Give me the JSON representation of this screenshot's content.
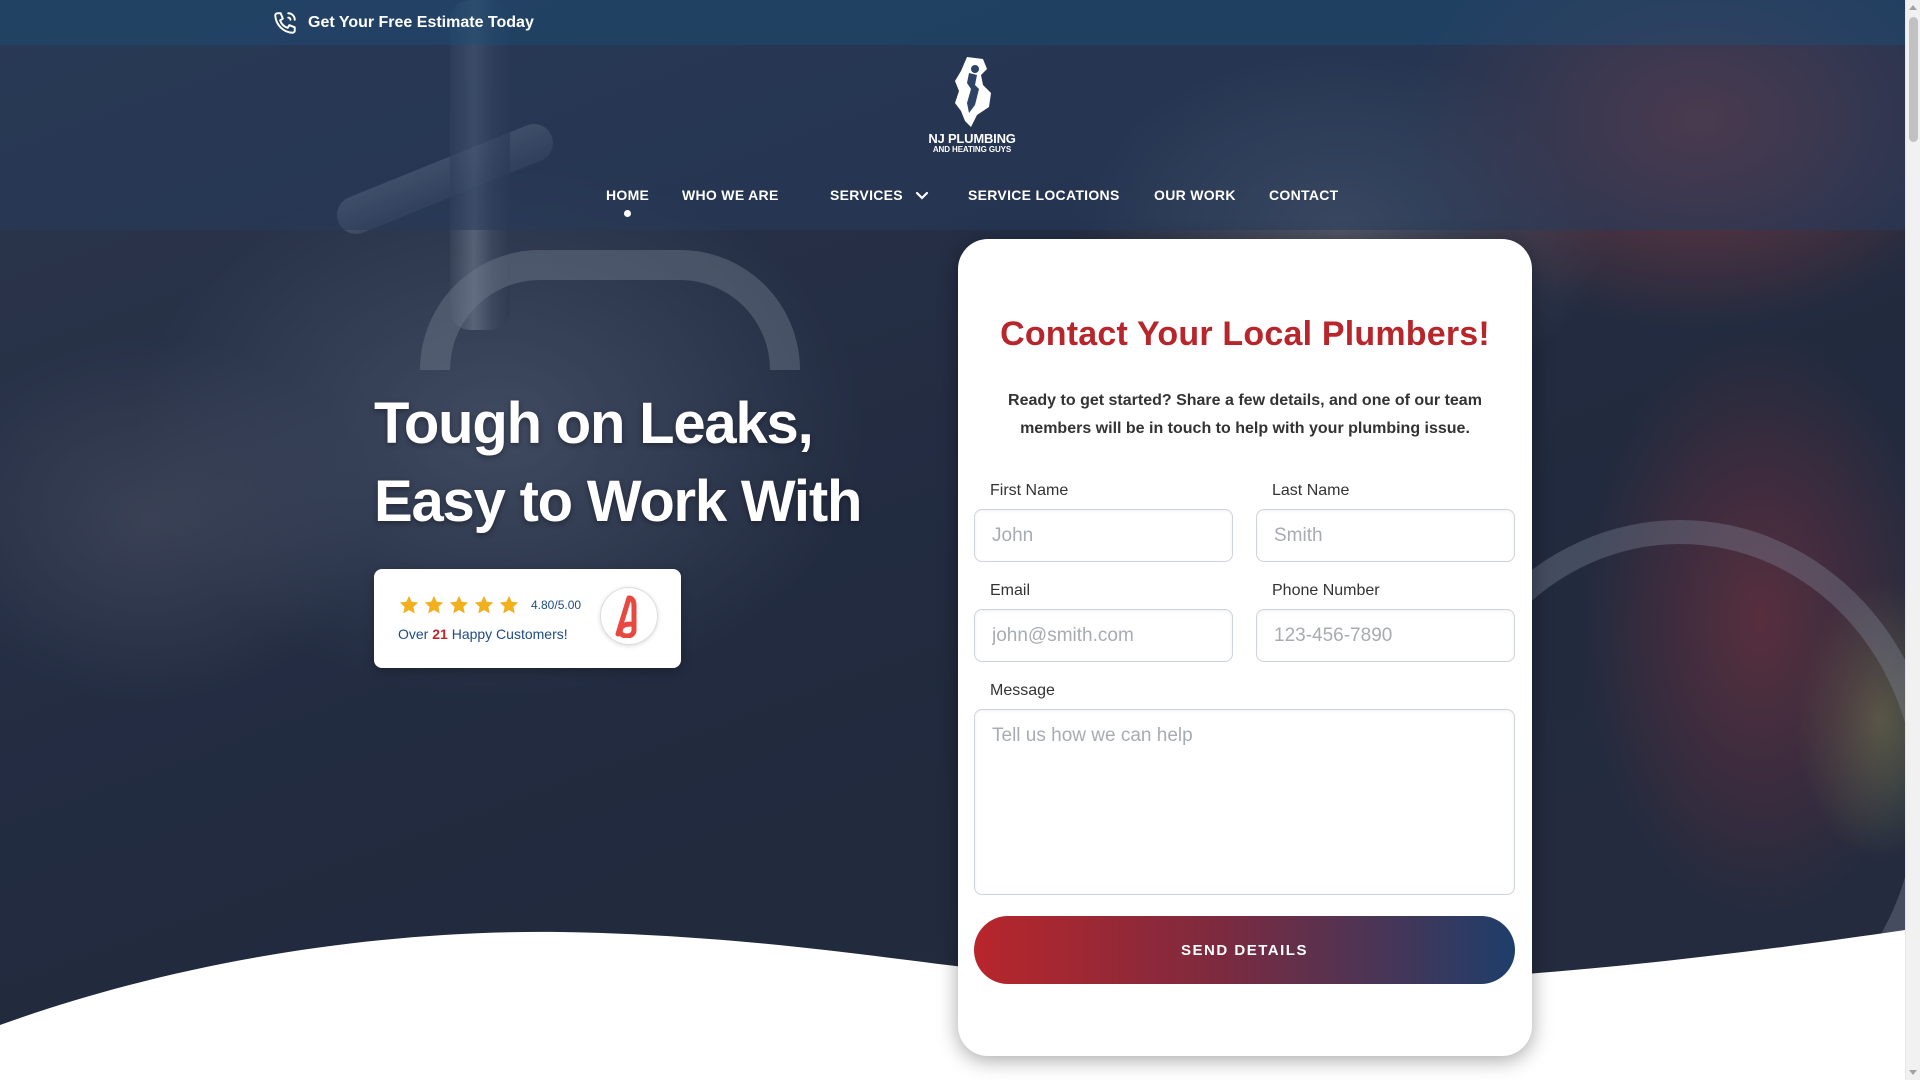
{
  "topbar": {
    "estimate_label": "Get Your Free Estimate Today",
    "estimate_icon": "phone-call-icon"
  },
  "logo": {
    "name": "NJ PLUMBING",
    "sub": "AND HEATING GUYS",
    "icon": "nj-wrench-logo"
  },
  "nav": {
    "items": [
      {
        "label": "HOME",
        "active": true
      },
      {
        "label": "WHO WE ARE"
      },
      {
        "label": "SERVICES",
        "has_dropdown": true
      },
      {
        "label": "SERVICE LOCATIONS"
      },
      {
        "label": "OUR WORK"
      },
      {
        "label": "CONTACT"
      }
    ]
  },
  "hero": {
    "title_line1": "Tough on Leaks,",
    "title_line2": "Easy to Work With"
  },
  "badge": {
    "stars": 5,
    "rating": "4.80/5.00",
    "customers_prefix": "Over",
    "customers_count": "21",
    "customers_suffix": "Happy Customers!",
    "star_color": "#f2b01e",
    "platform_icon": "angi-logo-icon"
  },
  "form": {
    "title": "Contact Your Local Plumbers!",
    "intro": "Ready to get started? Share a few details, and one of our team members will be in touch to help with your plumbing issue.",
    "first_name": {
      "label": "First Name",
      "placeholder": "John",
      "value": ""
    },
    "last_name": {
      "label": "Last Name",
      "placeholder": "Smith",
      "value": ""
    },
    "email": {
      "label": "Email",
      "placeholder": "john@smith.com",
      "value": ""
    },
    "phone": {
      "label": "Phone Number",
      "placeholder": "123-456-7890",
      "value": ""
    },
    "message": {
      "label": "Message",
      "placeholder": "Tell us how we can help",
      "value": ""
    },
    "submit_label": "SEND DETAILS"
  },
  "colors": {
    "brand_red": "#b8262b",
    "brand_blue": "#1e3e6a",
    "text_blue": "#1f4b86"
  }
}
